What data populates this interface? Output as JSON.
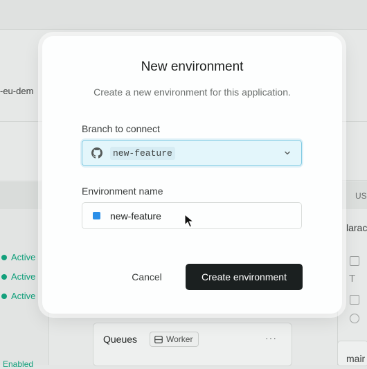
{
  "background": {
    "left_text": "-eu-dem",
    "statuses": [
      "Active",
      "Active",
      "Active"
    ],
    "bottom_left_text": "Enabled",
    "right_header": "US",
    "right_item": "larac",
    "right_bottom": "mair",
    "card": {
      "title": "Queues",
      "badge": "Worker",
      "more": "···"
    }
  },
  "modal": {
    "title": "New environment",
    "subtitle": "Create a new environment for this application.",
    "branch_label": "Branch to connect",
    "branch_value": "new-feature",
    "env_label": "Environment name",
    "env_value": "new-feature",
    "env_color": "#2b8fe8",
    "cancel_label": "Cancel",
    "create_label": "Create environment"
  },
  "icons": {
    "branch_icon": "github-icon",
    "select_icon": "chevron-down-icon"
  },
  "colors": {
    "accent_focus": "#7ec9e2",
    "primary_button": "#1b2020",
    "status_active": "#13a07c"
  }
}
